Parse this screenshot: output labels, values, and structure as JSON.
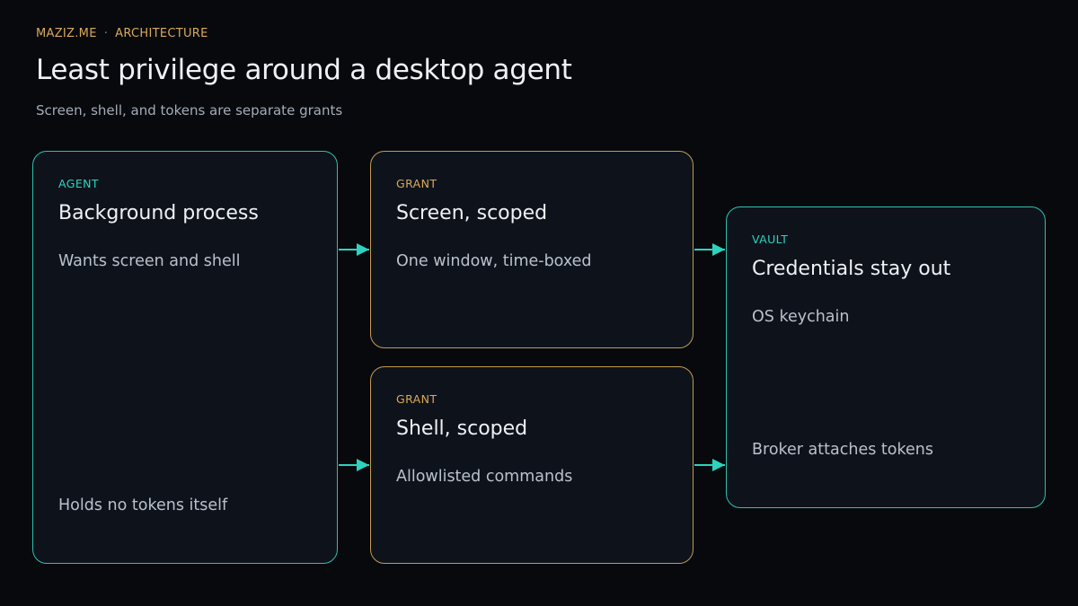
{
  "header": {
    "brand": "MAZIZ.ME",
    "separator": "·",
    "section": "ARCHITECTURE",
    "title": "Least privilege around a desktop agent",
    "subtitle": "Screen, shell, and tokens are separate grants"
  },
  "cards": {
    "agent": {
      "kicker": "AGENT",
      "heading": "Background process",
      "line1": "Wants screen and shell",
      "line2": "Holds no tokens itself"
    },
    "grant_screen": {
      "kicker": "GRANT",
      "heading": "Screen, scoped",
      "line1": "One window, time-boxed"
    },
    "grant_shell": {
      "kicker": "GRANT",
      "heading": "Shell, scoped",
      "line1": "Allowlisted commands"
    },
    "vault": {
      "kicker": "VAULT",
      "heading": "Credentials stay out",
      "line1": "OS keychain",
      "line2": "Broker attaches tokens"
    }
  },
  "colors": {
    "teal": "#2ed3bf",
    "gold": "#d9a95b",
    "background": "#07090d",
    "card": "#0e131b"
  },
  "icons": {
    "connector": "arrow-right-icon"
  }
}
